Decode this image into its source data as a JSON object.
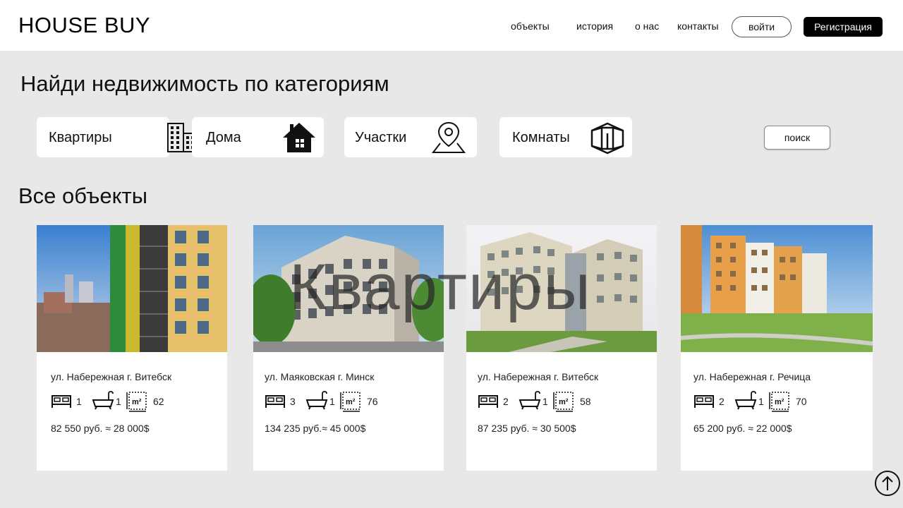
{
  "header": {
    "logo": "HOUSE BUY",
    "nav": [
      "объекты",
      "история",
      "о нас",
      "контакты"
    ],
    "login": "войти",
    "register": "Регистрация"
  },
  "categories_section": {
    "title": "Найди недвижимость по категориям",
    "items": [
      {
        "label": "Квартиры",
        "icon": "apartment-building-icon"
      },
      {
        "label": "Дома",
        "icon": "house-icon"
      },
      {
        "label": "Участки",
        "icon": "map-pin-icon"
      },
      {
        "label": "Комнаты",
        "icon": "room-icon"
      }
    ],
    "search_button": "поиск"
  },
  "listings": {
    "title": "Все объекты",
    "overlay_text": "Квартиры",
    "cards": [
      {
        "address": "ул. Набережная  г. Витебск",
        "beds": "1",
        "baths": "1",
        "area": "62",
        "price": "82 550 руб. ≈ 28 000$"
      },
      {
        "address": "ул. Маяковская  г. Минск",
        "beds": "3",
        "baths": "1",
        "area": "76",
        "price": "134 235 руб.≈ 45 000$"
      },
      {
        "address": "ул. Набережная   г. Витебск",
        "beds": "2",
        "baths": "1",
        "area": "58",
        "price": "87 235 руб.  ≈ 30 500$"
      },
      {
        "address": "ул. Набережная  г. Речица",
        "beds": "2",
        "baths": "1",
        "area": "70",
        "price": "65 200 руб.  ≈ 22 000$"
      }
    ],
    "area_unit_icon_text": "m²"
  },
  "colors": {
    "background": "#e8e8e8",
    "header_bg": "#ffffff",
    "register_bg": "#000000"
  },
  "icons": {
    "scroll_top": "arrow-up-circle-icon",
    "bed": "bed-icon",
    "bath": "bathtub-icon",
    "area": "area-m2-icon"
  }
}
